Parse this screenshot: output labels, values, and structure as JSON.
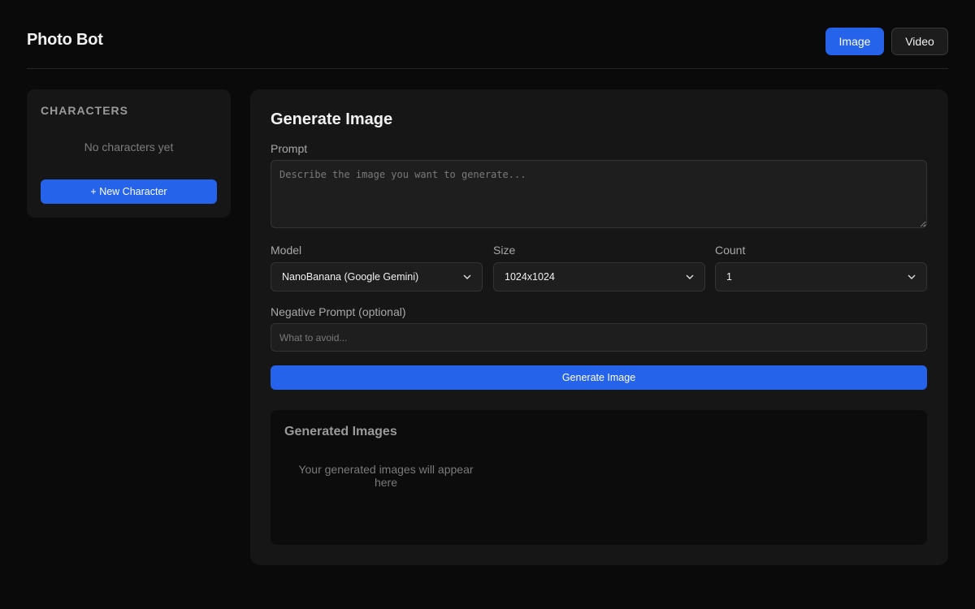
{
  "app": {
    "title": "Photo Bot"
  },
  "mode_tabs": [
    {
      "label": "Image",
      "active": true
    },
    {
      "label": "Video",
      "active": false
    }
  ],
  "sidebar": {
    "heading": "CHARACTERS",
    "empty_text": "No characters yet",
    "new_button_label": "+ New Character"
  },
  "main": {
    "title": "Generate Image",
    "prompt": {
      "label": "Prompt",
      "placeholder": "Describe the image you want to generate...",
      "value": ""
    },
    "model": {
      "label": "Model",
      "value": "NanoBanana (Google Gemini)"
    },
    "size": {
      "label": "Size",
      "value": "1024x1024"
    },
    "count": {
      "label": "Count",
      "value": "1"
    },
    "negative_prompt": {
      "label": "Negative Prompt (optional)",
      "placeholder": "What to avoid...",
      "value": ""
    },
    "generate_button_label": "Generate Image",
    "results": {
      "title": "Generated Images",
      "empty_text": "Your generated images will appear here"
    }
  },
  "colors": {
    "background": "#0a0a0a",
    "panel": "#161616",
    "accent": "#2563eb",
    "input_bg": "#1e1e1e"
  },
  "icons": {
    "select_chevron": "chevron-down-icon",
    "textarea_resize": "resize-grip-icon"
  }
}
